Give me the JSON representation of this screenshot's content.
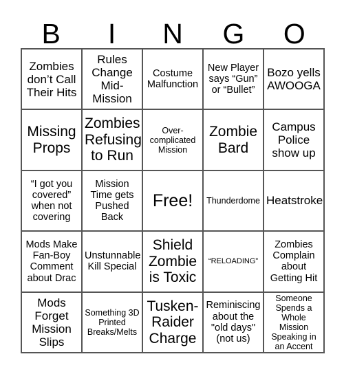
{
  "card": {
    "header_letters": [
      "B",
      "I",
      "N",
      "G",
      "O"
    ],
    "grid_size": 5,
    "border_color": "#555555",
    "background_color": "#ffffff",
    "text_color": "#000000",
    "free_space": {
      "row": 3,
      "column": 3,
      "label": "Free!"
    },
    "rows": [
      [
        {
          "text": "Zombies don’t Call Their Hits",
          "size": "fs-md"
        },
        {
          "text": "Rules Change Mid-Mission",
          "size": "fs-md"
        },
        {
          "text": "Costume Malfunction",
          "size": "fs-sm"
        },
        {
          "text": "New Player says “Gun” or “Bullet”",
          "size": "fs-sm"
        },
        {
          "text": "Bozo yells AWOOGA",
          "size": "fs-md"
        }
      ],
      [
        {
          "text": "Missing Props",
          "size": "fs-lg"
        },
        {
          "text": "Zombies Refusing to Run",
          "size": "fs-lg"
        },
        {
          "text": "Over-complicated Mission",
          "size": "fs-xs"
        },
        {
          "text": "Zombie Bard",
          "size": "fs-lg"
        },
        {
          "text": "Campus Police show up",
          "size": "fs-md"
        }
      ],
      [
        {
          "text": "“I got you covered” when not covering",
          "size": "fs-sm"
        },
        {
          "text": "Mission Time gets Pushed Back",
          "size": "fs-sm"
        },
        {
          "text": "Free!",
          "size": "fs-xl"
        },
        {
          "text": "Thunderdome",
          "size": "fs-xs"
        },
        {
          "text": "Heatstroke",
          "size": "fs-md"
        }
      ],
      [
        {
          "text": "Mods Make Fan-Boy Comment about Drac",
          "size": "fs-sm"
        },
        {
          "text": "Unstunnable Kill Special",
          "size": "fs-sm"
        },
        {
          "text": "Shield Zombie is Toxic",
          "size": "fs-lg"
        },
        {
          "text": "“RELOADING”",
          "size": "fs-xxs"
        },
        {
          "text": "Zombies Complain about Getting Hit",
          "size": "fs-sm"
        }
      ],
      [
        {
          "text": "Mods Forget Mission Slips",
          "size": "fs-md"
        },
        {
          "text": "Something 3D Printed Breaks/Melts",
          "size": "fs-xs"
        },
        {
          "text": "Tusken-Raider Charge",
          "size": "fs-lg"
        },
        {
          "text": "Reminiscing about the \"old days\" (not us)",
          "size": "fs-sm"
        },
        {
          "text": "Someone Spends a Whole Mission Speaking in an Accent",
          "size": "fs-xs"
        }
      ]
    ]
  }
}
